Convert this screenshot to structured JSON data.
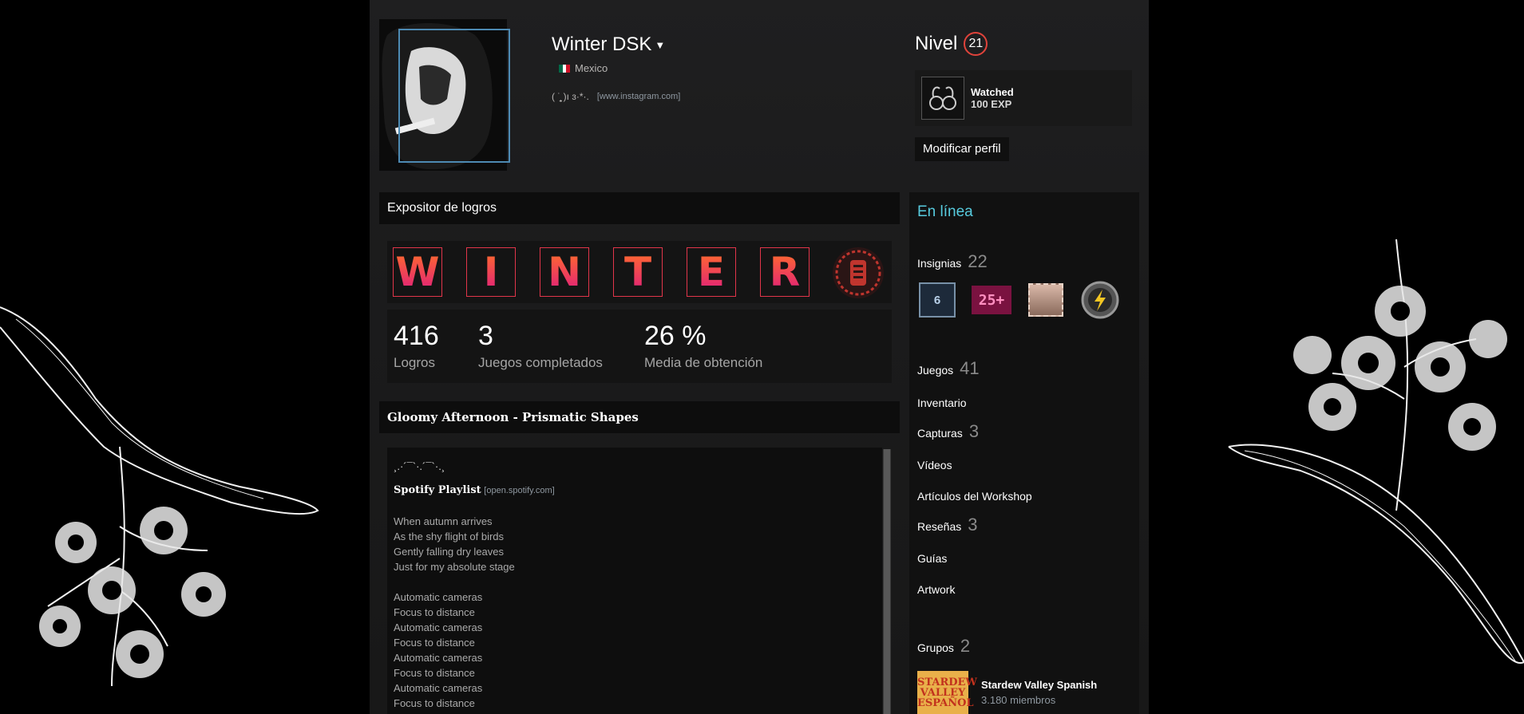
{
  "header": {
    "persona_name": "Winter DSK",
    "country": "Mexico",
    "summary_text": "( ˙̮̩̥̩̥̩̩̥ )ı ɜ·*·.",
    "summary_link": "[www.instagram.com]",
    "level_label": "Nivel",
    "level_value": "21",
    "featured_badge": {
      "name": "Watched",
      "xp": "100 EXP"
    },
    "edit_profile": "Modificar perfil"
  },
  "achievement_showcase": {
    "title": "Expositor de logros",
    "letters": [
      "W",
      "I",
      "N",
      "T",
      "E",
      "R"
    ],
    "stats": [
      {
        "value": "416",
        "label": "Logros"
      },
      {
        "value": "3",
        "label": "Juegos completados"
      },
      {
        "value": "26 %",
        "label": "Media de obtención"
      }
    ]
  },
  "custom_panel": {
    "title": "Gloomy Afternoon - Prismatic Shapes",
    "divider": "¸.·´¯`·.´¯`·.¸",
    "playlist_label": "Spotify Playlist",
    "playlist_link": "[open.spotify.com]",
    "lines": [
      "When autumn arrives",
      "As the shy flight of birds",
      "Gently falling dry leaves",
      "Just for my absolute stage",
      "",
      "Automatic cameras",
      "Focus to distance",
      "Automatic cameras",
      "Focus to distance",
      "Automatic cameras",
      "Focus to distance",
      "Automatic cameras",
      "Focus to distance"
    ]
  },
  "sidebar": {
    "status": "En línea",
    "badges_label": "Insignias",
    "badges_count": "22",
    "badge_icons": [
      "years-of-service-6-icon",
      "25-plus-badge-icon",
      "postcard-badge-icon",
      "lightning-badge-icon"
    ],
    "badge_six_text": "6",
    "badge_25_text": "25+",
    "games_label": "Juegos",
    "games_count": "41",
    "inventory_label": "Inventario",
    "screenshots_label": "Capturas",
    "screenshots_count": "3",
    "videos_label": "Vídeos",
    "workshop_label": "Artículos del Workshop",
    "reviews_label": "Reseñas",
    "reviews_count": "3",
    "guides_label": "Guías",
    "artwork_label": "Artwork",
    "groups_label": "Grupos",
    "groups_count": "2",
    "group": {
      "name": "Stardew Valley Spanish",
      "members": "3.180 miembros",
      "icon_text": "STARDEW VALLEY ESPAÑOL"
    }
  },
  "colors": {
    "accent_online": "#57cbde",
    "level_ring": "#e0433b",
    "achievement_border": "#e1354a"
  }
}
